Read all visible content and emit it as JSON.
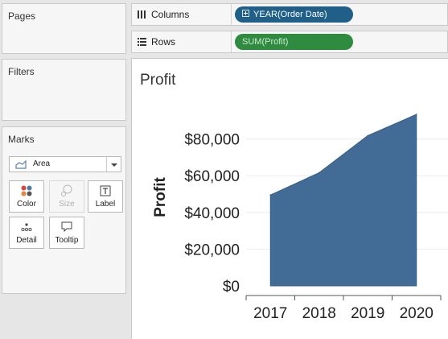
{
  "sidebar": {
    "pages_title": "Pages",
    "filters_title": "Filters",
    "marks": {
      "title": "Marks",
      "mark_type": "Area",
      "mark_type_icon": "area-chart-icon",
      "buttons": [
        {
          "label": "Color",
          "icon": "color-dots-icon"
        },
        {
          "label": "Size",
          "icon": "size-circles-icon"
        },
        {
          "label": "Label",
          "icon": "text-label-icon"
        },
        {
          "label": "Detail",
          "icon": "detail-dots-icon"
        },
        {
          "label": "Tooltip",
          "icon": "speech-bubble-icon"
        }
      ]
    }
  },
  "shelves": {
    "columns": {
      "label": "Columns",
      "icon": "columns-icon",
      "pill": "YEAR(Order Date)",
      "pill_color": "#1f5f88"
    },
    "rows": {
      "label": "Rows",
      "icon": "rows-icon",
      "pill": "SUM(Profit)",
      "pill_color": "#2e8b3f"
    }
  },
  "viz": {
    "title": "Profit"
  },
  "chart_data": {
    "type": "area",
    "title": "Profit",
    "xlabel": "",
    "ylabel": "Profit",
    "x": [
      "2017",
      "2018",
      "2019",
      "2020"
    ],
    "series": [
      {
        "values": [
          49500,
          61600,
          81800,
          93400
        ],
        "color": "#426c96"
      }
    ],
    "ylim": [
      0,
      100000
    ],
    "yticks": [
      0,
      20000,
      40000,
      60000,
      80000
    ],
    "ytick_labels": [
      "$0",
      "$20,000",
      "$40,000",
      "$60,000",
      "$80,000"
    ],
    "grid": true,
    "legend": "none"
  }
}
